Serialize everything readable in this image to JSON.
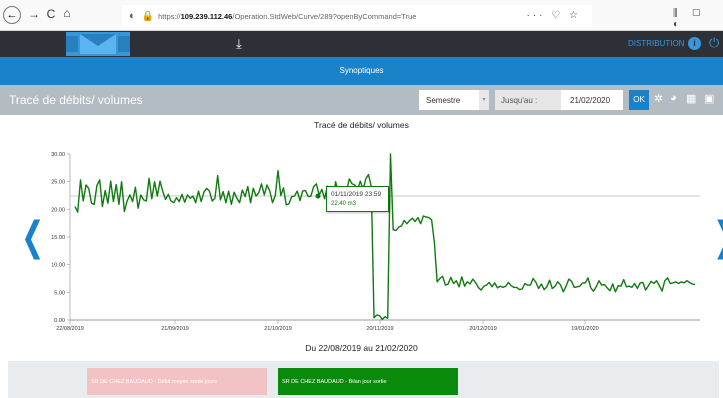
{
  "browser": {
    "url_prefix": "https://",
    "url_host": "109.239.112.46",
    "url_path": "/Operation.StdWeb/Curve/289?openByCommand=True",
    "nav_back": "←",
    "nav_forward": "→",
    "nav_reload": "C",
    "nav_home": "⌂",
    "url_shield": "◐",
    "url_lock": "🔒",
    "url_extra": "··· ♡ ☆",
    "right_tools": "⫼ ▢ ◐"
  },
  "header": {
    "download_icon": "⤓",
    "distribution_label": "DISTRIBUTION",
    "info_icon": "i",
    "power_icon": "⏻"
  },
  "nav": {
    "synoptiques_label": "Synoptiques"
  },
  "toolbar": {
    "page_title": "Tracé de débits/ volumes",
    "period_value": "Semestre",
    "period_caret": "▾",
    "until_label": "Jusqu'au :",
    "date_value": "21/02/2020",
    "ok_label": "OK",
    "icons": [
      "gear-icon",
      "pie-chart-icon",
      "grid-icon",
      "image-icon"
    ],
    "icon_glyphs": [
      "✲",
      "◕",
      "▦",
      "▣"
    ]
  },
  "chart": {
    "title": "Tracé de débits/ volumes",
    "caption": "Du 22/08/2019 au 21/02/2020",
    "prev_arrow": "❮",
    "next_arrow": "❯",
    "tooltip_line1": "01/11/2019 23:59",
    "tooltip_line2": "22.40 m3"
  },
  "chart_data": {
    "type": "line",
    "title": "Tracé de débits/ volumes",
    "xlabel": "Du 22/08/2019 au 21/02/2020",
    "ylabel": "",
    "ylim": [
      0,
      30
    ],
    "yticks": [
      "0.00",
      "5.00",
      "10.00",
      "15.00",
      "20.00",
      "25.00",
      "30.00"
    ],
    "xticks": [
      "22/08/2019",
      "21/09/2019",
      "21/10/2019",
      "20/11/2019",
      "20/12/2019",
      "19/01/2020"
    ],
    "reference_line": 22.4,
    "color": "#0f7a0f",
    "grid": false,
    "series": [
      {
        "values": [
          20.5,
          19.5,
          25.3,
          21.5,
          24.4,
          23.8,
          21.1,
          20.9,
          24.3,
          25.3,
          20.5,
          23.4,
          21.1,
          25.1,
          21.4,
          24.5,
          20.9,
          25.0,
          19.6,
          21.5,
          22.6,
          21.4,
          24.0,
          20.2,
          22.6,
          21.7,
          21.5,
          25.6,
          21.9,
          25.0,
          22.4,
          25.1,
          23.2,
          21.8,
          22.7,
          21.5,
          21.2,
          22.1,
          21.4,
          22.7,
          21.3,
          22.6,
          22.0,
          22.4,
          21.2,
          23.3,
          21.4,
          23.1,
          23.8,
          23.3,
          21.5,
          22.0,
          26.1,
          21.7,
          23.2,
          21.2,
          23.3,
          20.9,
          23.1,
          22.0,
          21.2,
          23.5,
          22.3,
          24.1,
          21.2,
          23.8,
          22.4,
          23.0,
          24.6,
          22.6,
          24.4,
          23.3,
          21.2,
          22.5,
          27.0,
          22.5,
          23.9,
          20.8,
          21.0,
          22.3,
          22.4,
          23.3,
          21.6,
          23.3,
          23.4,
          22.3,
          22.4,
          24.1,
          24.6,
          22.6,
          23.6,
          21.9,
          24.2,
          23.6,
          21.6,
          25.0,
          22.9,
          23.2,
          23.0,
          23.4,
          25.5,
          24.6,
          24.4,
          23.5,
          25.1,
          23.6,
          25.5,
          26.3,
          24.1,
          0.4,
          0.9,
          0.8,
          0.1,
          0.6,
          0.3,
          31.0,
          16.3,
          16.2,
          16.8,
          17.0,
          18.0,
          17.4,
          18.0,
          18.4,
          17.8,
          18.5,
          17.4,
          18.8,
          18.6,
          18.5,
          18.1,
          14.0,
          6.9,
          7.5,
          7.9,
          6.3,
          6.5,
          7.7,
          6.6,
          7.1,
          6.0,
          7.8,
          6.1,
          6.9,
          6.5,
          7.4,
          6.8,
          5.9,
          5.4,
          6.1,
          6.3,
          6.8,
          6.0,
          6.7,
          5.8,
          6.1,
          5.9,
          6.1,
          6.8,
          6.2,
          5.9,
          5.9,
          5.5,
          5.6,
          6.6,
          6.3,
          6.3,
          7.5,
          6.8,
          5.7,
          6.5,
          5.5,
          6.0,
          7.2,
          5.7,
          6.1,
          6.9,
          6.3,
          5.1,
          6.1,
          7.4,
          7.0,
          5.9,
          6.0,
          6.1,
          6.7,
          6.7,
          7.6,
          5.8,
          5.2,
          6.0,
          7.1,
          6.3,
          6.4,
          5.8,
          5.3,
          6.5,
          5.1,
          6.2,
          6.1,
          7.3,
          6.0,
          6.1,
          5.9,
          6.6,
          5.7,
          6.7,
          6.8,
          5.4,
          6.2,
          7.0,
          6.6,
          7.1,
          6.2,
          5.2,
          7.1,
          7.6,
          6.6,
          6.7,
          6.9,
          6.6,
          6.9,
          6.7,
          7.1,
          6.8,
          6.5,
          6.4
        ]
      }
    ]
  },
  "legend": {
    "red_label": "SR DE CHEZ BAUDAUD - Débit moyen sortie jours",
    "green_label": "SR DE CHEZ BAUDAUD - Bilan jour sortie",
    "red_color": "#f2c2c4",
    "green_color": "#0a8a0a"
  }
}
